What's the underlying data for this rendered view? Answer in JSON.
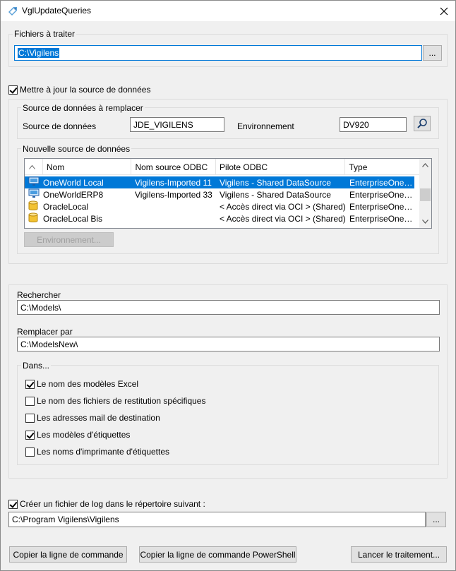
{
  "window": {
    "title": "VglUpdateQueries"
  },
  "files_group": {
    "title": "Fichiers à traiter",
    "path_value": "C:\\Vigilens",
    "browse_label": "..."
  },
  "update_source": {
    "checkbox_label": "Mettre à jour la source de données",
    "checked": true,
    "replace_group": {
      "title": "Source de données à remplacer",
      "source_label": "Source de données",
      "source_value": "JDE_VIGILENS",
      "env_label": "Environnement",
      "env_value": "DV920"
    },
    "new_group": {
      "title": "Nouvelle source de données",
      "columns": [
        "Nom",
        "Nom source ODBC",
        "Pilote ODBC",
        "Type"
      ],
      "rows": [
        {
          "icon": "monitor-icon",
          "name": "OneWorld Local",
          "odbc": "Vigilens-Imported 11",
          "driver": "Vigilens - Shared DataSource",
          "type": "EnterpriseOne…",
          "selected": true
        },
        {
          "icon": "monitor-icon",
          "name": "OneWorldERP8",
          "odbc": "Vigilens-Imported 33",
          "driver": "Vigilens - Shared DataSource",
          "type": "EnterpriseOne…",
          "selected": false
        },
        {
          "icon": "database-icon",
          "name": "OracleLocal",
          "odbc": "",
          "driver": "< Accès direct via OCI > (Shared)",
          "type": "EnterpriseOne…",
          "selected": false
        },
        {
          "icon": "database-icon",
          "name": "OracleLocal Bis",
          "odbc": "",
          "driver": "< Accès direct via OCI > (Shared)",
          "type": "EnterpriseOne…",
          "selected": false
        }
      ],
      "env_button_label": "Environnement..."
    }
  },
  "search": {
    "search_label": "Rechercher",
    "search_value": "C:\\Models\\",
    "replace_label": "Remplacer par",
    "replace_value": "C:\\ModelsNew\\",
    "in_group": {
      "title": "Dans...",
      "options": [
        {
          "label": "Le nom des modèles Excel",
          "checked": true
        },
        {
          "label": "Le nom des fichiers de restitution spécifiques",
          "checked": false
        },
        {
          "label": "Les adresses mail de destination",
          "checked": false
        },
        {
          "label": "Les modèles d'étiquettes",
          "checked": true
        },
        {
          "label": "Les noms d'imprimante d'étiquettes",
          "checked": false
        }
      ]
    }
  },
  "log": {
    "checkbox_label": "Créer un fichier de log dans le répertoire suivant :",
    "checked": true,
    "path_value": "C:\\Program Vigilens\\Vigilens",
    "browse_label": "..."
  },
  "actions": {
    "copy_cmd_label": "Copier la ligne de commande",
    "copy_ps_label": "Copier la ligne de commande PowerShell",
    "run_label": "Lancer le traitement..."
  },
  "colors": {
    "selection": "#0078d7",
    "window_bg": "#f0f0f0",
    "focus_border": "#0078d7"
  }
}
